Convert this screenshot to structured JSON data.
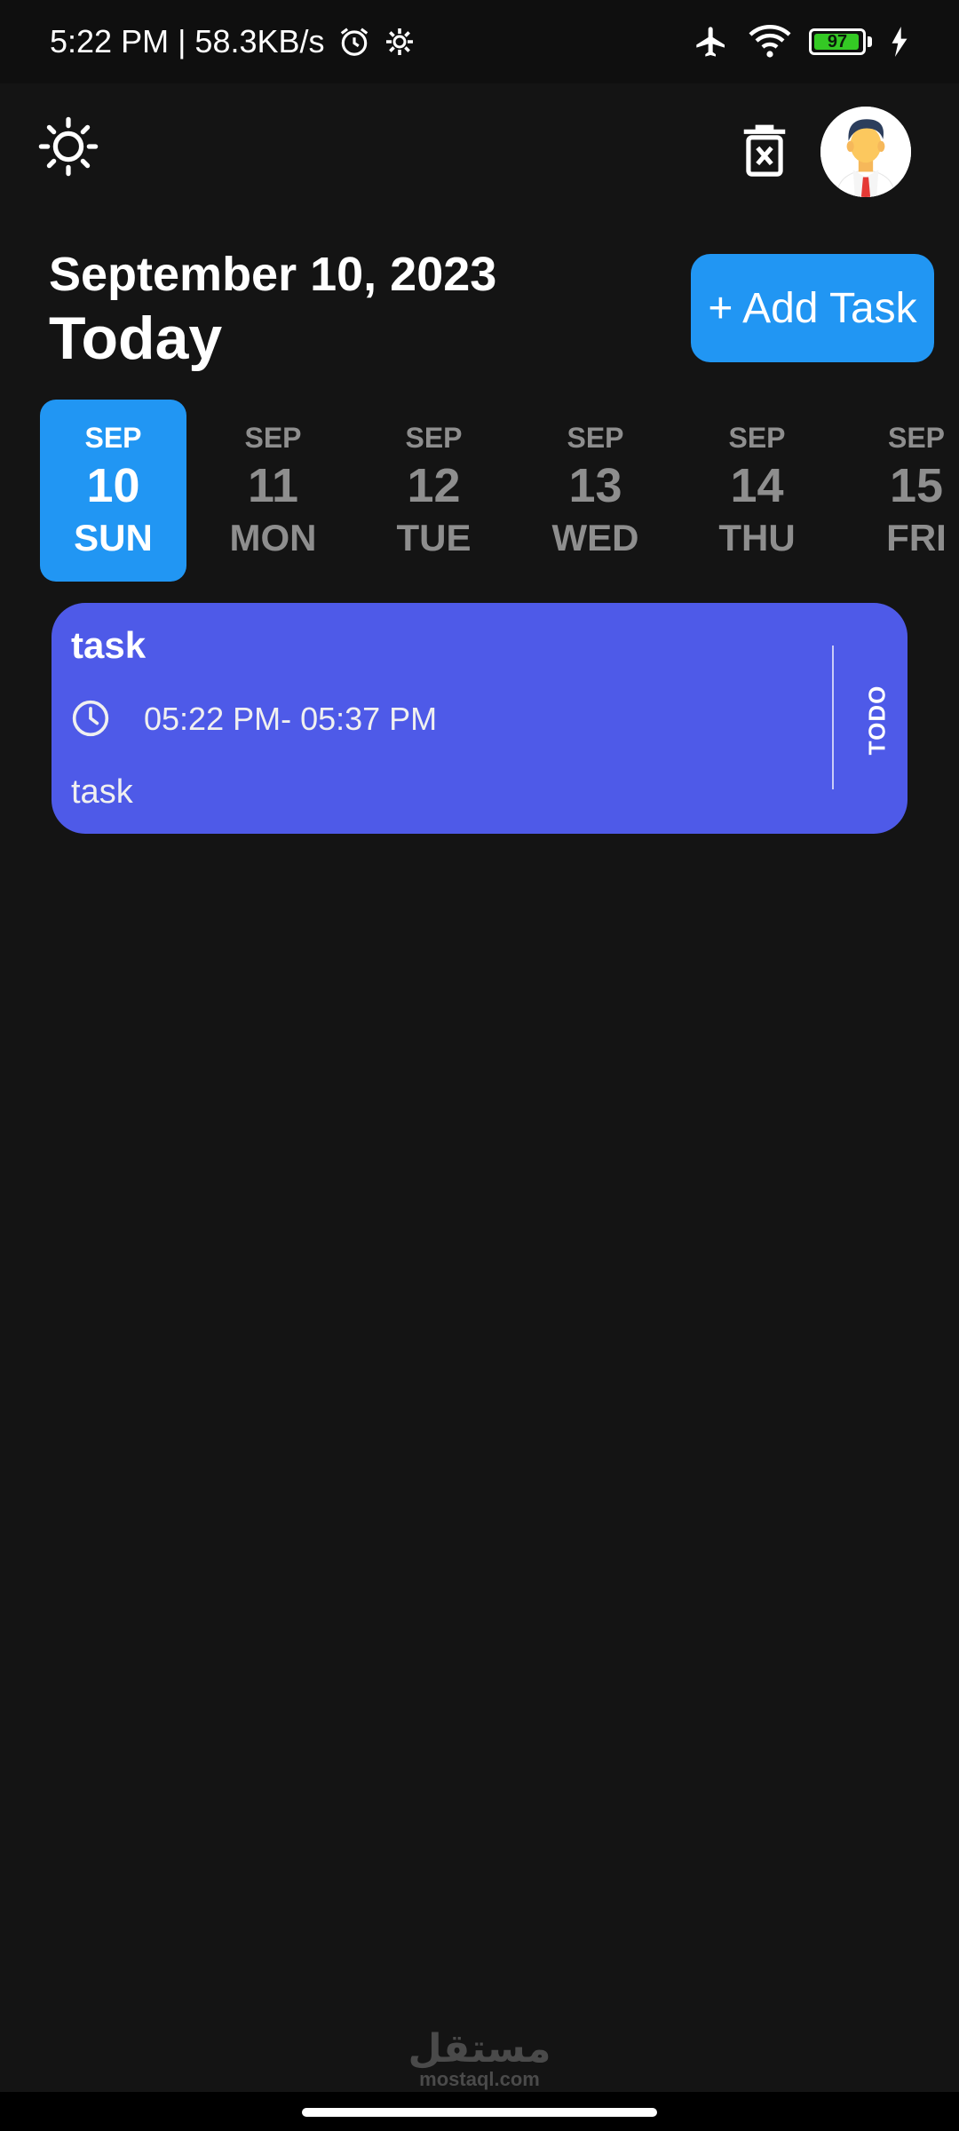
{
  "status_bar": {
    "time_speed": "5:22 PM | 58.3KB/s",
    "icons": [
      "alarm-icon",
      "settings-gear-icon",
      "airplane-mode-icon",
      "wifi-icon",
      "battery-icon",
      "charging-icon"
    ],
    "battery_level": "97",
    "battery_fraction": 0.97
  },
  "header": {
    "theme_icon": "sun-icon",
    "delete_icon": "trash-icon",
    "avatar_icon": "profile-avatar"
  },
  "hero": {
    "date": "September 10, 2023",
    "today": "Today",
    "add_button": "+ Add Task"
  },
  "date_strip": {
    "items": [
      {
        "month": "SEP",
        "day": "10",
        "weekday": "SUN",
        "selected": true
      },
      {
        "month": "SEP",
        "day": "11",
        "weekday": "MON",
        "selected": false
      },
      {
        "month": "SEP",
        "day": "12",
        "weekday": "TUE",
        "selected": false
      },
      {
        "month": "SEP",
        "day": "13",
        "weekday": "WED",
        "selected": false
      },
      {
        "month": "SEP",
        "day": "14",
        "weekday": "THU",
        "selected": false
      },
      {
        "month": "SEP",
        "day": "15",
        "weekday": "FRI",
        "selected": false
      }
    ]
  },
  "tasks": [
    {
      "title": "task",
      "time": "05:22 PM- 05:37 PM",
      "note": "task",
      "status": "TODO",
      "color": "#4e5ae8"
    }
  ],
  "colors": {
    "background": "#141414",
    "accent": "#2196f3",
    "task_card": "#4e5ae8",
    "inactive_date": "#8e8e8e"
  },
  "watermark": {
    "arabic": "مستقل",
    "latin": "mostaql.com"
  }
}
